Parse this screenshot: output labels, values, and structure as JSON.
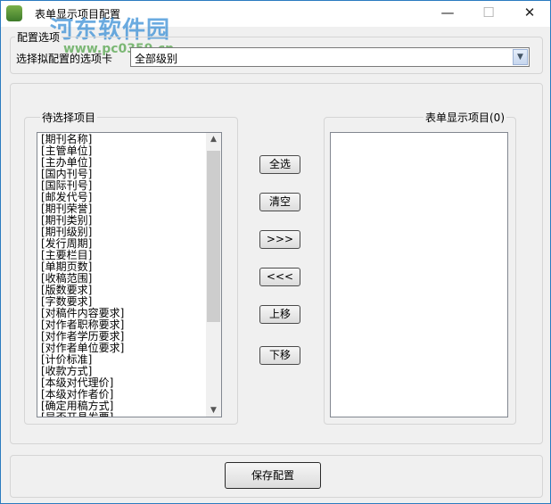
{
  "window": {
    "title": "表单显示项目配置",
    "minimize": "—",
    "maximize": "☐",
    "close": "✕"
  },
  "watermark": {
    "name": "河东软件园",
    "url": "www.pc0359.cn"
  },
  "config_group": {
    "label": "配置选项",
    "select_label": "选择拟配置的选项卡",
    "select_value": "全部级别"
  },
  "available": {
    "label": "待选择项目",
    "items": [
      "[期刊名称]",
      "[主管单位]",
      "[主办单位]",
      "[国内刊号]",
      "[国际刊号]",
      "[邮发代号]",
      "[期刊荣誉]",
      "[期刊类别]",
      "[期刊级别]",
      "[发行周期]",
      "[主要栏目]",
      "[单期页数]",
      "[收稿范围]",
      "[版数要求]",
      "[字数要求]",
      "[对稿件内容要求]",
      "[对作者职称要求]",
      "[对作者学历要求]",
      "[对作者单位要求]",
      "[计价标准]",
      "[收款方式]",
      "[本级对代理价]",
      "[本级对作者价]",
      "[确定用稿方式]",
      "[是否开具发票]"
    ]
  },
  "selected": {
    "label": "表单显示项目(0)",
    "items": []
  },
  "buttons": {
    "select_all": "全选",
    "clear": "清空",
    "add": ">>>",
    "remove": "<<<",
    "move_up": "上移",
    "move_down": "下移",
    "save": "保存配置"
  }
}
